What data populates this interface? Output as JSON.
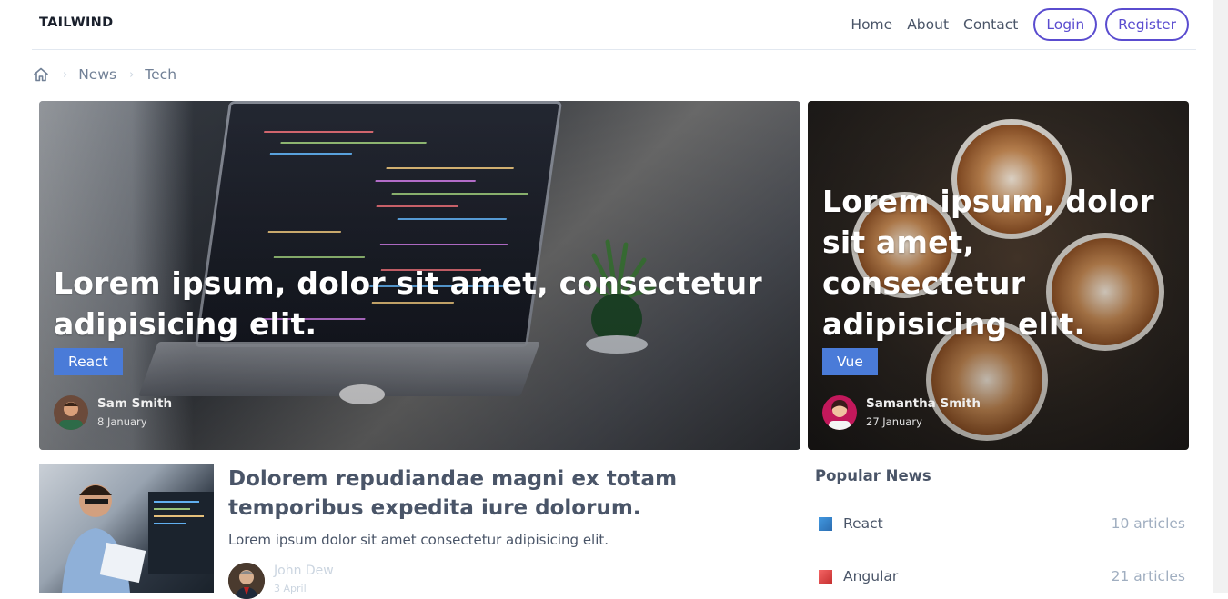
{
  "navbar": {
    "logo": "TAILWIND",
    "links": [
      "Home",
      "About",
      "Contact"
    ],
    "login": "Login",
    "register": "Register"
  },
  "breadcrumb": {
    "items": [
      "News",
      "Tech"
    ]
  },
  "featured": [
    {
      "title": "Lorem ipsum, dolor sit amet, consectetur adipisicing elit.",
      "tag": "React",
      "tag_color": "#4a7bd8",
      "author": "Sam Smith",
      "date": "8 January"
    },
    {
      "title": "Lorem ipsum, dolor sit amet, consectetur adipisicing elit.",
      "tag": "Vue",
      "tag_color": "#4a7bd8",
      "author": "Samantha Smith",
      "date": "27 January"
    }
  ],
  "post": {
    "title": "Dolorem repudiandae magni ex totam temporibus expedita iure dolorum.",
    "excerpt": "Lorem ipsum dolor sit amet consectetur adipisicing elit.",
    "author": "John Dew",
    "date": "3 April"
  },
  "sidebar": {
    "title": "Popular News",
    "items": [
      {
        "name": "React",
        "count": "10 articles",
        "color": "#3182ce"
      },
      {
        "name": "Angular",
        "count": "21 articles",
        "color": "#e53e3e"
      }
    ]
  },
  "colors": {
    "accent": "#5a4ccf",
    "tag": "#4a7bd8"
  }
}
